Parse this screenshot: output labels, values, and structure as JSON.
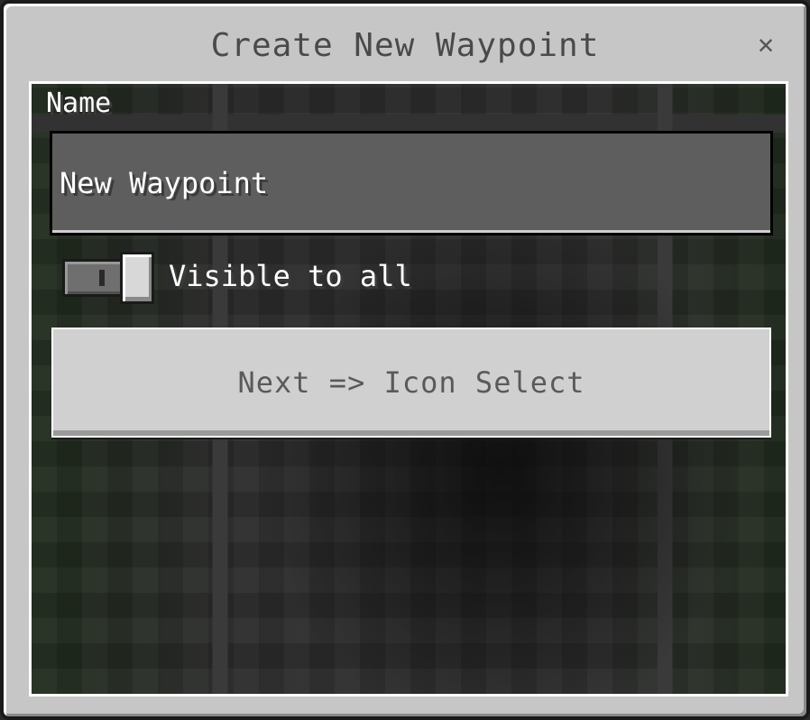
{
  "dialog": {
    "title": "Create New Waypoint",
    "close_glyph": "✕"
  },
  "form": {
    "name_label": "Name",
    "name_value": "New Waypoint",
    "visibility": {
      "label": "Visible to all",
      "enabled": false
    },
    "next_button_label": "Next => Icon Select"
  }
}
